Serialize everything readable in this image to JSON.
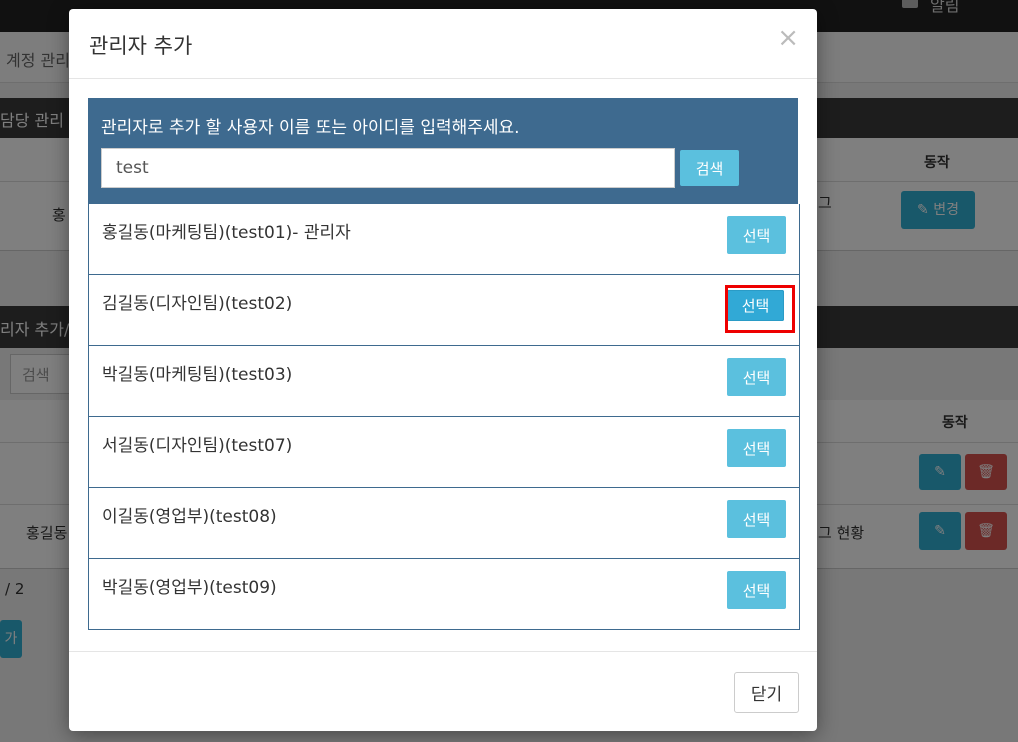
{
  "background": {
    "alert_label": "알림",
    "breadcrumb": "계정 관리",
    "panel1_title": "담당 관리",
    "panel1_action_header": "동작",
    "panel1_row_name": "홍",
    "panel1_row_extra": "그",
    "panel1_change_label": "변경",
    "panel2_title": "리자 추가/",
    "search_placeholder": "검색",
    "panel2_action_header": "동작",
    "panel2_row2_name": "홍길동",
    "panel2_row2_extra": "그 현황",
    "pagination": "/ 2",
    "add_label": "가"
  },
  "modal": {
    "title": "관리자 추가",
    "close_symbol": "×",
    "search_label": "관리자로 추가 할 사용자 이름 또는 아이디를 입력해주세요.",
    "search_value": "test",
    "search_button": "검색",
    "results": [
      {
        "name": "홍길동(마케팅팀)(test01)- 관리자",
        "button": "선택"
      },
      {
        "name": "김길동(디자인팀)(test02)",
        "button": "선택"
      },
      {
        "name": "박길동(마케팅팀)(test03)",
        "button": "선택"
      },
      {
        "name": "서길동(디자인팀)(test07)",
        "button": "선택"
      },
      {
        "name": "이길동(영업부)(test08)",
        "button": "선택"
      },
      {
        "name": "박길동(영업부)(test09)",
        "button": "선택"
      }
    ],
    "close_button": "닫기"
  },
  "colors": {
    "header_band": "#3e6a8f",
    "button_info": "#5bc0de",
    "highlight": "#ee0000"
  }
}
